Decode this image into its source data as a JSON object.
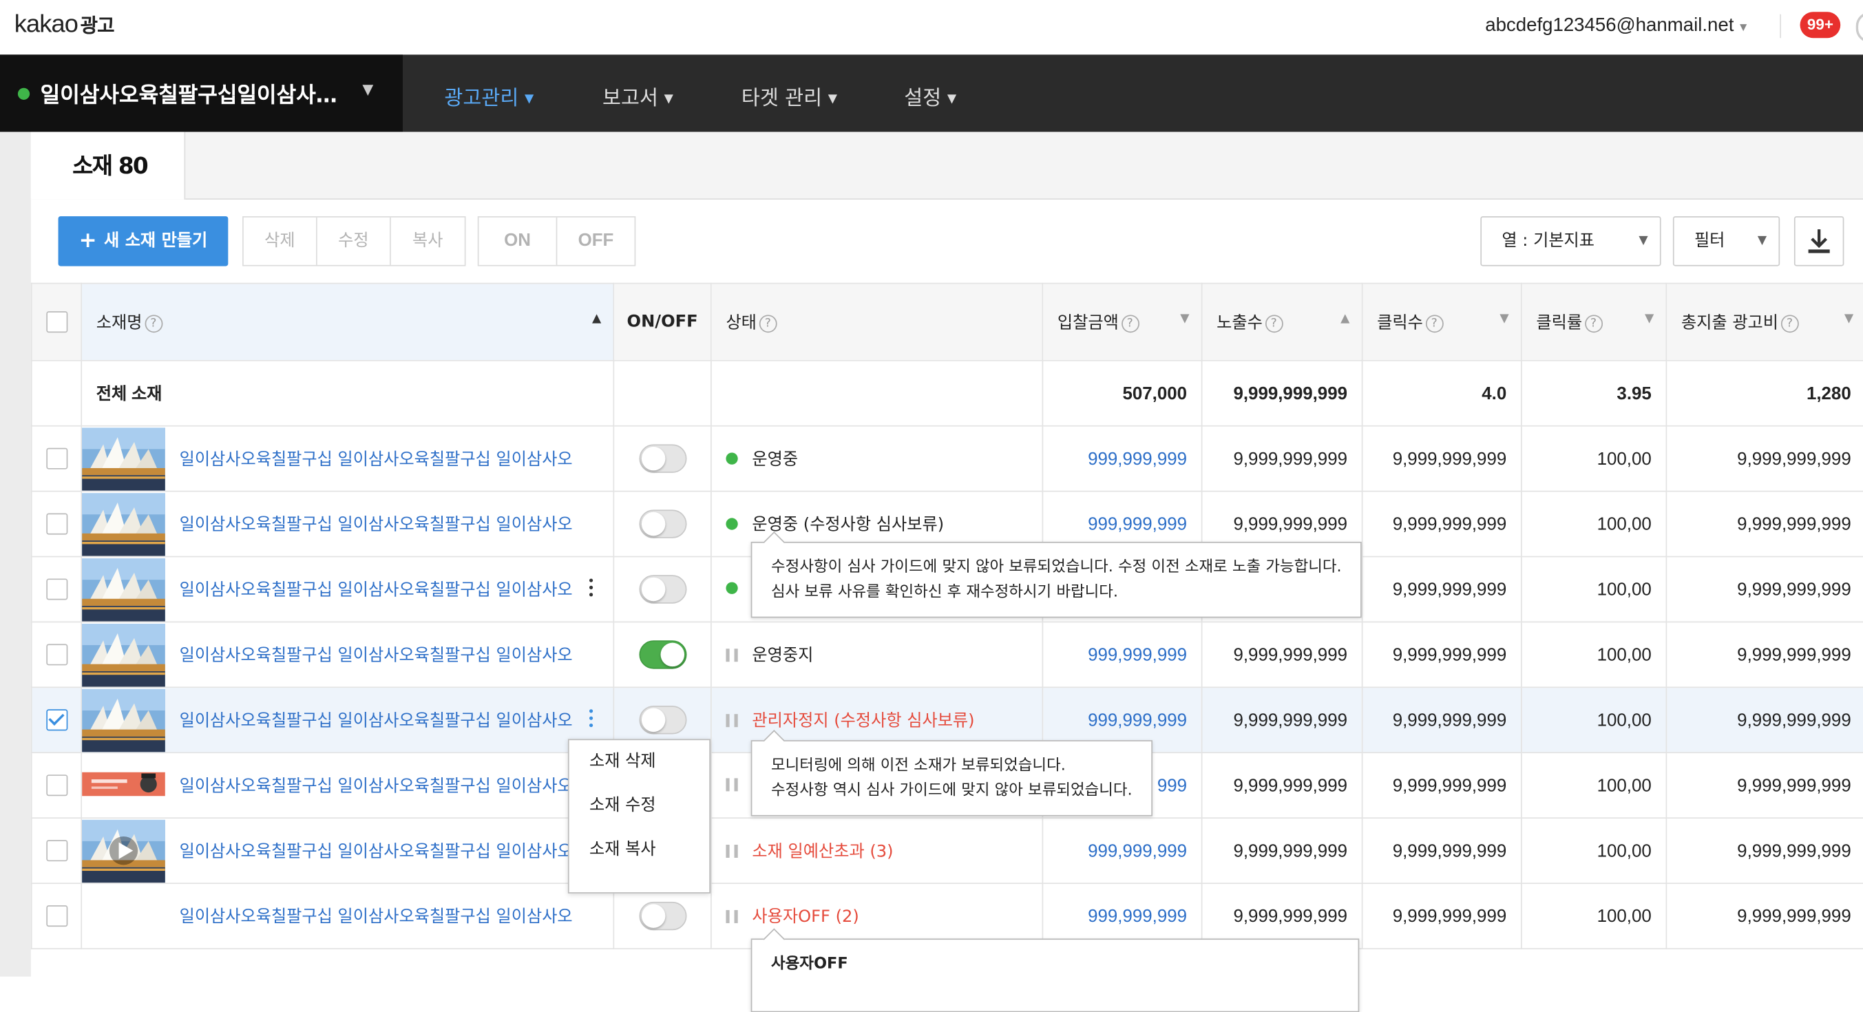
{
  "header": {
    "logo_text": "kakao",
    "logo_suffix": "광고",
    "user_email": "abcdefg123456@hanmail.net",
    "notification_count": "99+"
  },
  "nav": {
    "account_name": "일이삼사오육칠팔구십일이삼사오육칠팔구십",
    "menu": [
      {
        "label": "광고관리",
        "active": true
      },
      {
        "label": "보고서",
        "active": false
      },
      {
        "label": "타겟 관리",
        "active": false
      },
      {
        "label": "설정",
        "active": false
      }
    ]
  },
  "tab": {
    "label": "소재 80"
  },
  "toolbar": {
    "new_button": "새 소재 만들기",
    "edit_group": [
      "삭제",
      "수정",
      "복사"
    ],
    "onoff_group": [
      "ON",
      "OFF"
    ],
    "columns_select": "열 : 기본지표",
    "filter_select": "필터"
  },
  "table": {
    "headers": [
      "소재명",
      "ON/OFF",
      "상태",
      "입찰금액",
      "노출수",
      "클릭수",
      "클릭률",
      "총지출 광고비"
    ],
    "total": {
      "label": "전체 소재",
      "bid": "507,000",
      "impressions": "9,999,999,999",
      "clicks": "4.0",
      "ctr": "3.95",
      "spend": "1,280"
    },
    "rows": [
      {
        "name": "일이삼사오육칠팔구십 일이삼사오육칠팔구십 일이삼사오",
        "on": false,
        "status": "운영중",
        "status_type": "green",
        "bid": "999,999,999",
        "impressions": "9,999,999,999",
        "clicks": "9,999,999,999",
        "ctr": "100,00",
        "spend": "9,999,999,999",
        "checked": false,
        "kebab": false
      },
      {
        "name": "일이삼사오육칠팔구십 일이삼사오육칠팔구십 일이삼사오",
        "on": false,
        "status": "운영중 (수정사항 심사보류)",
        "status_type": "green",
        "bid": "999,999,999",
        "impressions": "9,999,999,999",
        "clicks": "9,999,999,999",
        "ctr": "100,00",
        "spend": "9,999,999,999",
        "checked": false,
        "kebab": false
      },
      {
        "name": "일이삼사오육칠팔구십 일이삼사오육칠팔구십 일이삼사오",
        "on": false,
        "status": "",
        "status_type": "green",
        "bid": "",
        "impressions": "",
        "clicks": "9,999,999,999",
        "ctr": "100,00",
        "spend": "9,999,999,999",
        "checked": false,
        "kebab": true
      },
      {
        "name": "일이삼사오육칠팔구십 일이삼사오육칠팔구십 일이삼사오",
        "on": true,
        "status": "운영중지",
        "status_type": "pause",
        "bid": "999,999,999",
        "impressions": "9,999,999,999",
        "clicks": "9,999,999,999",
        "ctr": "100,00",
        "spend": "9,999,999,999",
        "checked": false,
        "kebab": false
      },
      {
        "name": "일이삼사오육칠팔구십 일이삼사오육칠팔구십 일이삼사오",
        "on": false,
        "status": "관리자정지 (수정사항 심사보류)",
        "status_type": "pause-red",
        "bid": "999,999,999",
        "impressions": "9,999,999,999",
        "clicks": "9,999,999,999",
        "ctr": "100,00",
        "spend": "9,999,999,999",
        "checked": true,
        "kebab": true
      },
      {
        "name": "일이삼사오육칠팔구십 일이삼사오육칠팔구십 일이삼사오",
        "on": false,
        "status": "",
        "status_type": "pause",
        "bid": "999",
        "impressions": "9,999,999,999",
        "clicks": "9,999,999,999",
        "ctr": "100,00",
        "spend": "9,999,999,999",
        "checked": false,
        "kebab": false
      },
      {
        "name": "일이삼사오육칠팔구십 일이삼사오육칠팔구십 일이삼사오",
        "on": false,
        "status": "소재 일예산초과 (3)",
        "status_type": "pause-red",
        "bid": "999,999,999",
        "impressions": "9,999,999,999",
        "clicks": "9,999,999,999",
        "ctr": "100,00",
        "spend": "9,999,999,999",
        "checked": false,
        "kebab": false
      },
      {
        "name": "일이삼사오육칠팔구십 일이삼사오육칠팔구십 일이삼사오",
        "on": false,
        "status": "사용자OFF (2)",
        "status_type": "pause-red",
        "bid": "999,999,999",
        "impressions": "9,999,999,999",
        "clicks": "9,999,999,999",
        "ctr": "100,00",
        "spend": "9,999,999,999",
        "checked": false,
        "kebab": false
      }
    ]
  },
  "tooltips": {
    "review_hold": [
      "수정사항이 심사 가이드에 맞지 않아 보류되었습니다. 수정 이전 소재로 노출 가능합니다.",
      "심사 보류 사유를 확인하신 후 재수정하시기 바랍니다."
    ],
    "monitoring": [
      "모니터링에 의해 이전 소재가 보류되었습니다.",
      "수정사항 역시 심사 가이드에 맞지 않아 보류되었습니다."
    ],
    "user_off": "사용자OFF"
  },
  "context_menu": [
    "소재 삭제",
    "소재 수정",
    "소재 복사"
  ],
  "colors": {
    "accent": "#3a8fe0",
    "link": "#2d6fc8",
    "active_menu": "#5aa9f5",
    "nav_bg": "#2b2b2b",
    "status_green": "#3fb549",
    "status_red": "#e54b3c",
    "badge": "#e8302d",
    "toggle_on": "#4cae4c"
  },
  "thumbnail_icons": [
    "opera-house-thumbnail",
    "opera-house-thumbnail",
    "opera-house-thumbnail",
    "opera-house-thumbnail",
    "opera-house-thumbnail",
    "banner-thumbnail",
    "video-thumbnail",
    ""
  ]
}
